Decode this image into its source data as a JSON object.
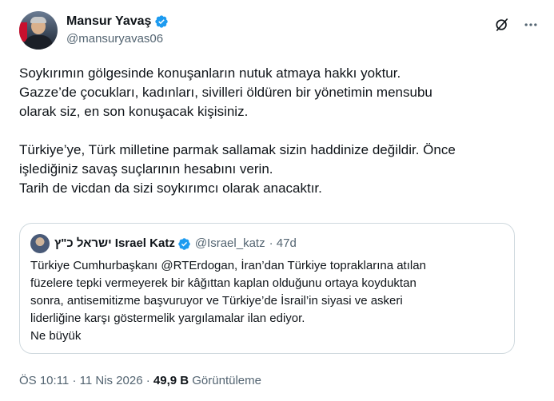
{
  "author": {
    "name": "Mansur Yavaş",
    "handle": "@mansuryavas06"
  },
  "tweet": {
    "lines": [
      "Soykırımın gölgesinde konuşanların nutuk atmaya hakkı yoktur.",
      "Gazze’de çocukları, kadınları, sivilleri öldüren bir yönetimin mensubu",
      "olarak siz, en son konuşacak kişisiniz.",
      "Türkiye’ye, Türk milletine parmak sallamak sizin haddinize değildir. Önce",
      "işlediğiniz savaş suçlarının hesabını verin.",
      "Tarih de vicdan da sizi soykırımcı olarak anacaktır."
    ]
  },
  "quote": {
    "name": "ישראל כ\"ץ Israel Katz",
    "handle": "@Israel_katz",
    "age": "· 47d",
    "lines": [
      "Türkiye Cumhurbaşkanı @RTErdogan, İran’dan Türkiye topraklarına atılan",
      "füzelere tepki vermeyerek bir kâğıttan kaplan olduğunu ortaya koyduktan",
      "sonra, antisemitizme başvuruyor ve Türkiye’de İsrail’in siyasi ve askeri",
      "liderliğine karşı göstermelik yargılamalar ilan ediyor.",
      "Ne büyük"
    ]
  },
  "meta": {
    "time": "ÖS 10:11",
    "date": "· 11 Nis 2026",
    "sep": "·",
    "views_count": "49,9 B",
    "views_label": "Görüntüleme"
  },
  "icons": {
    "verified": "verified-badge-icon",
    "grok": "grok-icon",
    "more": "more-icon"
  },
  "colors": {
    "verified": "#1d9bf0",
    "secondary_text": "#536471",
    "border": "#cfd9de"
  }
}
